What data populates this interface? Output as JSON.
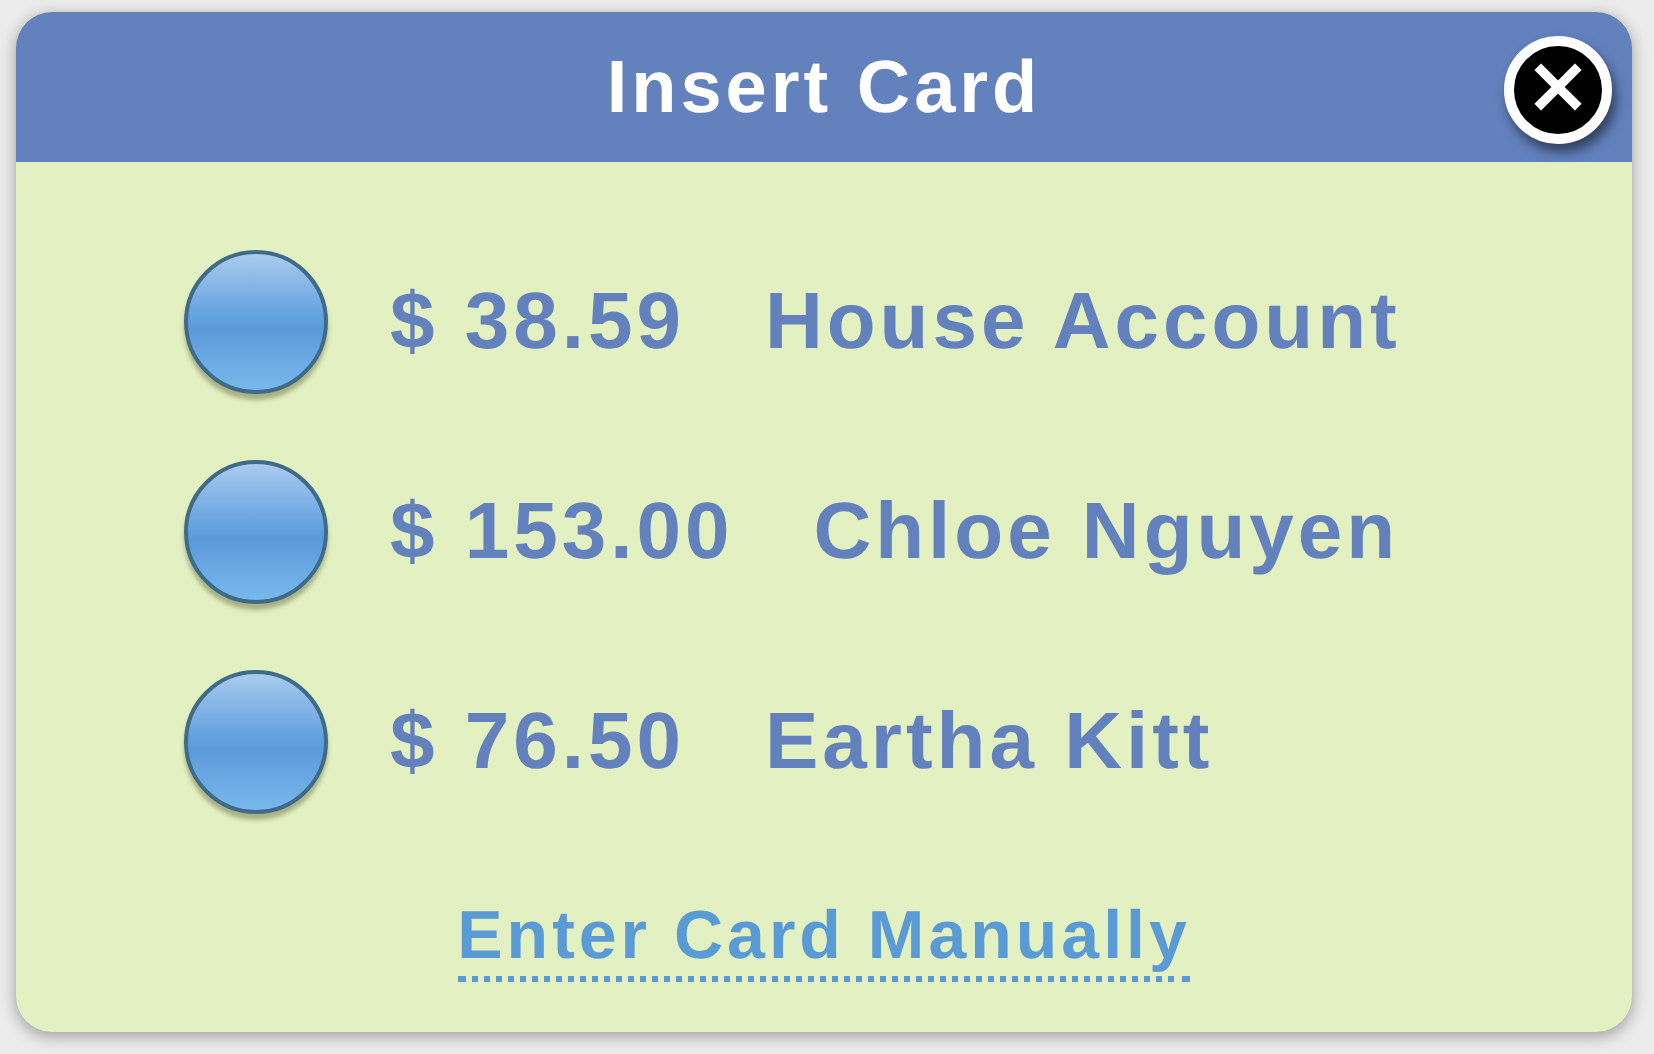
{
  "dialog": {
    "title": "Insert Card",
    "close": "×"
  },
  "cards": [
    {
      "amount": "$ 38.59",
      "name": "House Account",
      "selected": false
    },
    {
      "amount": "$ 153.00",
      "name": "Chloe Nguyen",
      "selected": false
    },
    {
      "amount": "$ 76.50",
      "name": "Eartha Kitt",
      "selected": false
    }
  ],
  "link": "Enter Card Manually"
}
